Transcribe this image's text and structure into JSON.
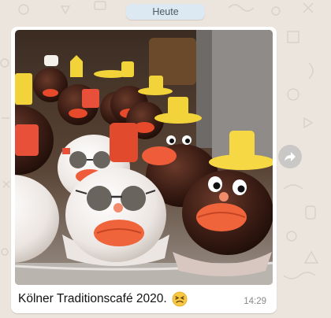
{
  "chat": {
    "date_separator": "Heute",
    "message": {
      "caption": "Kölner Traditionscafé 2020.",
      "emoji": "persevering-face-emoji",
      "time": "14:29",
      "image": "photo-of-decorated-chocolate-cakes-in-display-case"
    }
  },
  "colors": {
    "chat_background": "#ece5dd",
    "bubble": "#ffffff",
    "date_chip": "#dde9f2",
    "timestamp": "#8a8a8a"
  }
}
